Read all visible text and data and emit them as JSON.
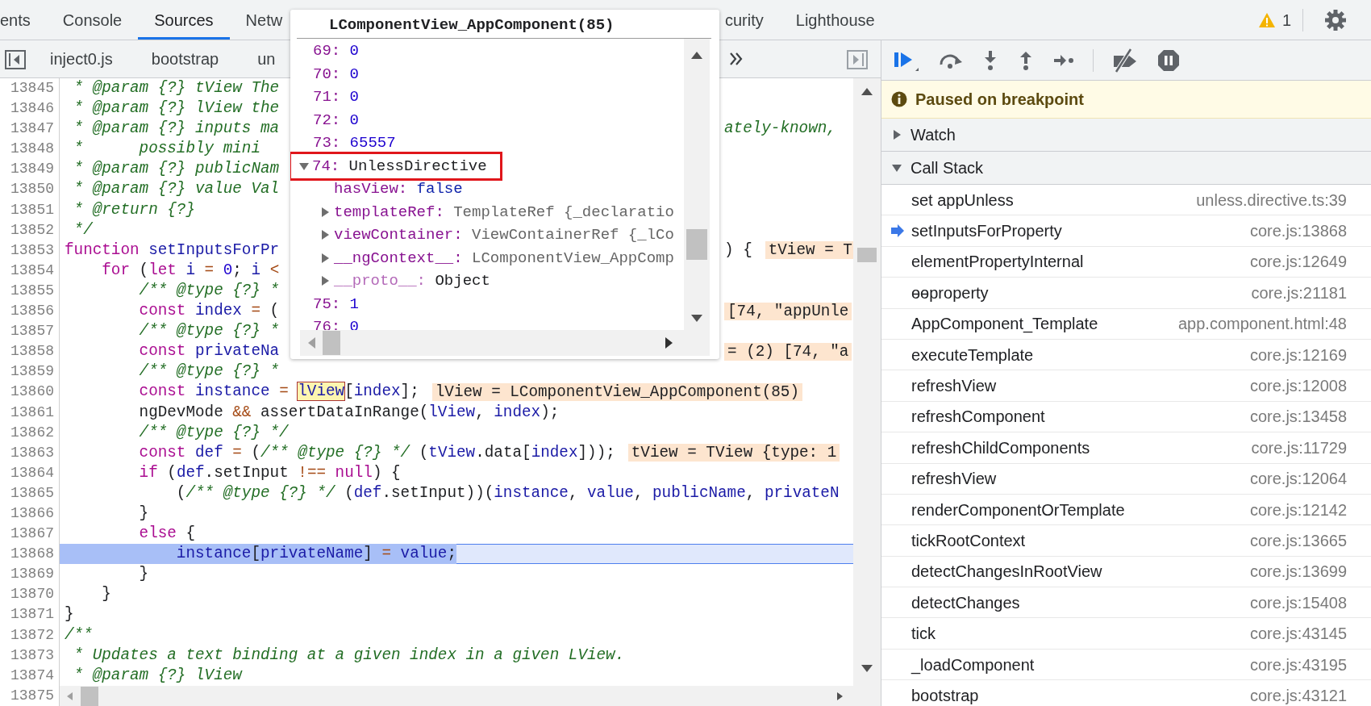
{
  "top_tabs": [
    {
      "label": "ents",
      "selected": false
    },
    {
      "label": "Console",
      "selected": false
    },
    {
      "label": "Sources",
      "selected": true
    },
    {
      "label": "Netw",
      "selected": false
    }
  ],
  "top_tabs_after_popover": [
    {
      "label": "curity",
      "selected": false
    },
    {
      "label": "Lighthouse",
      "selected": false
    }
  ],
  "warnings": "1",
  "file_tabs": [
    {
      "label": "inject0.js",
      "selected": false
    },
    {
      "label": "bootstrap",
      "selected": false
    },
    {
      "label": "un",
      "selected": false
    }
  ],
  "code_lines": [
    {
      "number": "13845",
      "current": false,
      "code": [
        {
          "kind": "cm",
          "text": " * @param {?} tView The"
        }
      ]
    },
    {
      "number": "13846",
      "current": false,
      "code": [
        {
          "kind": "cm",
          "text": " * @param {?} lView the"
        }
      ]
    },
    {
      "number": "13847",
      "current": false,
      "code": [
        {
          "kind": "cm",
          "text": " * @param {?} inputs ma"
        }
      ],
      "after_popover": {
        "code": [
          {
            "kind": "cm",
            "text": "ately-known,"
          }
        ]
      }
    },
    {
      "number": "13848",
      "current": false,
      "code": [
        {
          "kind": "cm",
          "text": " *      possibly mini"
        }
      ]
    },
    {
      "number": "13849",
      "current": false,
      "code": [
        {
          "kind": "cm",
          "text": " * @param {?} publicNam"
        }
      ]
    },
    {
      "number": "13850",
      "current": false,
      "code": [
        {
          "kind": "cm",
          "text": " * @param {?} value Val"
        }
      ]
    },
    {
      "number": "13851",
      "current": false,
      "code": [
        {
          "kind": "cm",
          "text": " * @return {?}"
        }
      ]
    },
    {
      "number": "13852",
      "current": false,
      "code": [
        {
          "kind": "cm",
          "text": " */"
        }
      ]
    },
    {
      "number": "13853",
      "current": false,
      "code": [
        {
          "kind": "kw",
          "text": "function"
        },
        {
          "kind": "id",
          "text": " setInputsForPr"
        }
      ],
      "after_popover": {
        "code": [
          {
            "kind": "pl",
            "text": ") {"
          }
        ],
        "value": "tView = T"
      }
    },
    {
      "number": "13854",
      "current": false,
      "code": [
        {
          "kind": "kw",
          "text": "    for"
        },
        {
          "kind": "pl",
          "text": " ("
        },
        {
          "kind": "kw",
          "text": "let"
        },
        {
          "kind": "id",
          "text": " i"
        },
        {
          "kind": "op",
          "text": " ="
        },
        {
          "kind": "num",
          "text": " 0"
        },
        {
          "kind": "pl",
          "text": "; "
        },
        {
          "kind": "id",
          "text": "i"
        },
        {
          "kind": "op",
          "text": " <"
        }
      ]
    },
    {
      "number": "13855",
      "current": false,
      "code": [
        {
          "kind": "cm",
          "text": "        /** @type {?} *"
        }
      ]
    },
    {
      "number": "13856",
      "current": false,
      "code": [
        {
          "kind": "kw",
          "text": "        const"
        },
        {
          "kind": "id",
          "text": " index"
        },
        {
          "kind": "op",
          "text": " ="
        },
        {
          "kind": "pl",
          "text": " ("
        }
      ],
      "after_popover": {
        "value": "[74, \"appUnle"
      }
    },
    {
      "number": "13857",
      "current": false,
      "code": [
        {
          "kind": "cm",
          "text": "        /** @type {?} *"
        }
      ]
    },
    {
      "number": "13858",
      "current": false,
      "code": [
        {
          "kind": "kw",
          "text": "        const"
        },
        {
          "kind": "id",
          "text": " privateNa"
        }
      ],
      "after_popover": {
        "value": "= (2) [74, \"a"
      }
    },
    {
      "number": "13859",
      "current": false,
      "code": [
        {
          "kind": "cm",
          "text": "        /** @type {?} *"
        }
      ]
    },
    {
      "number": "13860",
      "current": false,
      "code": [
        {
          "kind": "kw",
          "text": "        const"
        },
        {
          "kind": "id",
          "text": " instance"
        },
        {
          "kind": "op",
          "text": " = "
        },
        {
          "kind": "hover",
          "text": "lView"
        },
        {
          "kind": "pl",
          "text": "["
        },
        {
          "kind": "id",
          "text": "index"
        },
        {
          "kind": "pl",
          "text": "];"
        }
      ],
      "value": "lView = LComponentView_AppComponent(85)"
    },
    {
      "number": "13861",
      "current": false,
      "code": [
        {
          "kind": "pl",
          "text": "        ngDevMode "
        },
        {
          "kind": "op",
          "text": "&&"
        },
        {
          "kind": "pl",
          "text": " assertDataInRange("
        },
        {
          "kind": "id",
          "text": "lView"
        },
        {
          "kind": "pl",
          "text": ", "
        },
        {
          "kind": "id",
          "text": "index"
        },
        {
          "kind": "pl",
          "text": ");"
        }
      ]
    },
    {
      "number": "13862",
      "current": false,
      "code": [
        {
          "kind": "cm",
          "text": "        /** @type {?} */"
        }
      ]
    },
    {
      "number": "13863",
      "current": false,
      "code": [
        {
          "kind": "kw",
          "text": "        const"
        },
        {
          "kind": "id",
          "text": " def"
        },
        {
          "kind": "op",
          "text": " ="
        },
        {
          "kind": "pl",
          "text": " ("
        },
        {
          "kind": "cm",
          "text": "/** @type {?} */"
        },
        {
          "kind": "pl",
          "text": " ("
        },
        {
          "kind": "id",
          "text": "tView"
        },
        {
          "kind": "pl",
          "text": ".data["
        },
        {
          "kind": "id",
          "text": "index"
        },
        {
          "kind": "pl",
          "text": "]));"
        }
      ],
      "value": "tView = TView {type: 1"
    },
    {
      "number": "13864",
      "current": false,
      "code": [
        {
          "kind": "kw",
          "text": "        if"
        },
        {
          "kind": "pl",
          "text": " ("
        },
        {
          "kind": "id",
          "text": "def"
        },
        {
          "kind": "pl",
          "text": ".setInput "
        },
        {
          "kind": "op",
          "text": "!=="
        },
        {
          "kind": "kw",
          "text": " null"
        },
        {
          "kind": "pl",
          "text": ") {"
        }
      ]
    },
    {
      "number": "13865",
      "current": false,
      "code": [
        {
          "kind": "pl",
          "text": "            ("
        },
        {
          "kind": "cm",
          "text": "/** @type {?} */"
        },
        {
          "kind": "pl",
          "text": " ("
        },
        {
          "kind": "id",
          "text": "def"
        },
        {
          "kind": "pl",
          "text": ".setInput))("
        },
        {
          "kind": "id",
          "text": "instance"
        },
        {
          "kind": "pl",
          "text": ", "
        },
        {
          "kind": "id",
          "text": "value"
        },
        {
          "kind": "pl",
          "text": ", "
        },
        {
          "kind": "id",
          "text": "publicName"
        },
        {
          "kind": "pl",
          "text": ", "
        },
        {
          "kind": "id",
          "text": "privateN"
        }
      ]
    },
    {
      "number": "13866",
      "current": false,
      "code": [
        {
          "kind": "pl",
          "text": "        }"
        }
      ]
    },
    {
      "number": "13867",
      "current": false,
      "code": [
        {
          "kind": "kw",
          "text": "        else"
        },
        {
          "kind": "pl",
          "text": " {"
        }
      ]
    },
    {
      "number": "13868",
      "current": true,
      "code": [
        {
          "kind": "id",
          "text": "            instance"
        },
        {
          "kind": "pl",
          "text": "["
        },
        {
          "kind": "id",
          "text": "privateName"
        },
        {
          "kind": "pl",
          "text": "] "
        },
        {
          "kind": "op",
          "text": "="
        },
        {
          "kind": "id",
          "text": " value"
        },
        {
          "kind": "pl",
          "text": ";"
        }
      ]
    },
    {
      "number": "13869",
      "current": false,
      "code": [
        {
          "kind": "pl",
          "text": "        }"
        }
      ]
    },
    {
      "number": "13870",
      "current": false,
      "code": [
        {
          "kind": "pl",
          "text": "    }"
        }
      ]
    },
    {
      "number": "13871",
      "current": false,
      "code": [
        {
          "kind": "pl",
          "text": "}"
        }
      ]
    },
    {
      "number": "13872",
      "current": false,
      "code": [
        {
          "kind": "cm",
          "text": "/**"
        }
      ]
    },
    {
      "number": "13873",
      "current": false,
      "code": [
        {
          "kind": "cm",
          "text": " * Updates a text binding at a given index in a given LView."
        }
      ]
    },
    {
      "number": "13874",
      "current": false,
      "code": [
        {
          "kind": "cm",
          "text": " * @param {?} lView"
        }
      ]
    },
    {
      "number": "13875"
    }
  ],
  "popover": {
    "title": "LComponentView_AppComponent(85)",
    "entries": [
      {
        "key": "69:",
        "value": "0",
        "kind": "number",
        "highlighted": false
      },
      {
        "key": "70:",
        "value": "0",
        "kind": "number",
        "highlighted": false
      },
      {
        "key": "71:",
        "value": "0",
        "kind": "number",
        "highlighted": false
      },
      {
        "key": "72:",
        "value": "0",
        "kind": "number",
        "highlighted": false
      },
      {
        "key": "73:",
        "value": "65557",
        "kind": "number",
        "highlighted": false
      },
      {
        "key": "74:",
        "value": "UnlessDirective",
        "kind": "object",
        "expanded": true,
        "highlighted": true,
        "children": [
          {
            "key": "hasView:",
            "value": "false",
            "kind": "boolean"
          },
          {
            "key": "templateRef:",
            "value": "TemplateRef {_declaratio",
            "kind": "object",
            "expanded": false
          },
          {
            "key": "viewContainer:",
            "value": "ViewContainerRef {_lCo",
            "kind": "object",
            "expanded": false
          },
          {
            "key": "__ngContext__:",
            "value": "LComponentView_AppComp",
            "kind": "object",
            "expanded": false
          },
          {
            "key": "__proto__:",
            "value": "Object",
            "kind": "prototype",
            "expanded": false
          }
        ]
      },
      {
        "key": "75:",
        "value": "1",
        "kind": "number",
        "highlighted": false
      },
      {
        "key": "76:",
        "value": "0",
        "kind": "number",
        "highlighted": false
      }
    ]
  },
  "debugger": {
    "status": "Paused on breakpoint",
    "sections": [
      {
        "title": "Watch",
        "expanded": false
      },
      {
        "title": "Call Stack",
        "expanded": true
      }
    ],
    "call_stack": [
      {
        "name": "set appUnless",
        "location": "unless.directive.ts:39",
        "selected": false
      },
      {
        "name": "setInputsForProperty",
        "location": "core.js:13868",
        "selected": true
      },
      {
        "name": "elementPropertyInternal",
        "location": "core.js:12649",
        "selected": false
      },
      {
        "name": "ɵɵproperty",
        "location": "core.js:21181",
        "selected": false
      },
      {
        "name": "AppComponent_Template",
        "location": "app.component.html:48",
        "selected": false
      },
      {
        "name": "executeTemplate",
        "location": "core.js:12169",
        "selected": false
      },
      {
        "name": "refreshView",
        "location": "core.js:12008",
        "selected": false
      },
      {
        "name": "refreshComponent",
        "location": "core.js:13458",
        "selected": false
      },
      {
        "name": "refreshChildComponents",
        "location": "core.js:11729",
        "selected": false
      },
      {
        "name": "refreshView",
        "location": "core.js:12064",
        "selected": false
      },
      {
        "name": "renderComponentOrTemplate",
        "location": "core.js:12142",
        "selected": false
      },
      {
        "name": "tickRootContext",
        "location": "core.js:13665",
        "selected": false
      },
      {
        "name": "detectChangesInRootView",
        "location": "core.js:13699",
        "selected": false
      },
      {
        "name": "detectChanges",
        "location": "core.js:15408",
        "selected": false
      },
      {
        "name": "tick",
        "location": "core.js:43145",
        "selected": false
      },
      {
        "name": "_loadComponent",
        "location": "core.js:43195",
        "selected": false
      },
      {
        "name": "bootstrap",
        "location": "core.js:43121",
        "selected": false
      }
    ]
  }
}
